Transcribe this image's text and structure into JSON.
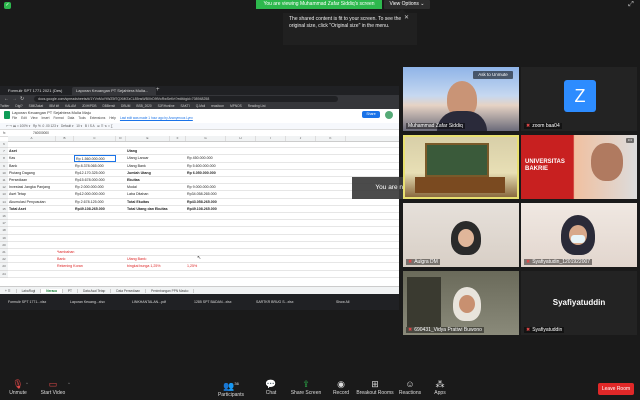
{
  "meeting": {
    "share_banner": "You are viewing Muhammad Zafar Siddiq's screen",
    "view_options": "View Options ⌄",
    "notice": "The shared content is fit to your screen. To see the original size, click \"Original size\" in the menu.",
    "breakout": "You are now in a Breakout Room"
  },
  "browser": {
    "tabs": [
      "Formulir SPT 1771 2021 (Des)",
      "Laporan Keuangan PT Sejahtera Mulia..."
    ],
    "url": "docs.google.com/spreadsheets/d/1YVnMuYtWZ5f7QXMfZzCL85nsWBXhD9fVoRwSeKrt?edit#gid=708948258",
    "bookmarks": [
      "Twitter",
      "Digi?",
      "SIMIZakat",
      "IBM kft",
      "KALAM",
      "JDIH/PDB",
      "DBBersit",
      "DBUM",
      "BSB_2020",
      "SJRHonline",
      "SAKTI",
      "Q-Mail",
      "reasitcon",
      "MPNOS",
      "Reading List"
    ],
    "doc_title": "Laporan Keuangan PT Sejahtera Mulia Maju",
    "doc_menu": [
      "File",
      "Edit",
      "View",
      "Insert",
      "Format",
      "Data",
      "Tools",
      "Extensions",
      "Help"
    ],
    "last_edit": "Last edit was made 1 hour ago by Anonymous Lynx",
    "share_label": "Share",
    "formula_value": "740000000",
    "sheet_tabs": [
      "LabaRugi",
      "Neraca",
      "PT",
      "Data Asal Tetap",
      "Data Persediaan",
      "Penimbangan PPN Masko"
    ],
    "active_sheet": "Neraca",
    "downloads": [
      "Formulir SPT 1771...xlsx",
      "Laporan Keuang...xlsx",
      "LINKHANTALAN...pdf",
      "1285 SPT BADAN...xlsx",
      "SARTKR BRUG S...xlsx"
    ],
    "show_all": "Show All"
  },
  "sheet": {
    "columns": [
      "A",
      "B",
      "C",
      "D",
      "E",
      "F",
      "G",
      "H",
      "I",
      "J",
      "K"
    ],
    "rows": [
      {
        "n": "6",
        "a": "",
        "c": "",
        "e": "",
        "g": ""
      },
      {
        "n": "7",
        "a": "Aset",
        "c": "",
        "e": "Utang",
        "g": "",
        "bold": true
      },
      {
        "n": "8",
        "a": "Kas",
        "c": "Rp  1.560.000.000",
        "e": "Utang Lancar",
        "g": "Rp    450.000.000"
      },
      {
        "n": "9",
        "a": "Bank",
        "c": "Rp  8.378.065.000",
        "e": "Utang Bank",
        "g": "Rp  5.600.000.000"
      },
      {
        "n": "10",
        "a": "Piutang Dagang",
        "c": "Rp12.170.325.000",
        "e": "Jumlah Utang",
        "g": "Rp  6.050.000.000",
        "bold_right": true
      },
      {
        "n": "11",
        "a": "Persediaan",
        "c": "Rp15.678.000.000",
        "e": "Ekuitas",
        "g": "",
        "bold_right": true
      },
      {
        "n": "12",
        "a": "Investasi Jangka Panjang",
        "c": "Rp  2.000.000.000",
        "e": "Modal",
        "g": "Rp  9.000.000.000"
      },
      {
        "n": "13",
        "a": "Aset Tetap",
        "c": "Rp12.000.000.000",
        "e": "Laba Ditahan",
        "g": "Rp34.058.265.000"
      },
      {
        "n": "14",
        "a": "Akumulasi Penyusutan",
        "c": "Rp  2.678.125.000",
        "e": "Total Ekuitas",
        "g": "Rp43.058.265.000",
        "bold_right": true
      },
      {
        "n": "15",
        "a": "Total Aset",
        "c": "Rp49.108.265.000",
        "e": "Total Utang dan Ekuitas",
        "g": "Rp49.108.265.000",
        "bold": true
      },
      {
        "n": "16",
        "a": "",
        "c": "",
        "e": "",
        "g": ""
      },
      {
        "n": "17",
        "a": "",
        "c": "",
        "e": "",
        "g": ""
      },
      {
        "n": "18",
        "a": "",
        "c": "",
        "e": "",
        "g": ""
      },
      {
        "n": "19",
        "a": "",
        "c": "",
        "e": "",
        "g": ""
      },
      {
        "n": "20",
        "a": "",
        "c": "",
        "e": "",
        "g": ""
      },
      {
        "n": "21",
        "a": "",
        "b": "*tambahan",
        "c": "",
        "e": "",
        "g": "",
        "red": true
      },
      {
        "n": "22",
        "a": "",
        "b": "Bank:",
        "c": "",
        "e": "Utang Bank:",
        "g": "",
        "red": true
      },
      {
        "n": "23",
        "a": "",
        "b": "   Rekening Koran",
        "c": "",
        "e": "   bingkai bunga 1,25%",
        "g": "1,25%",
        "red": true
      },
      {
        "n": "24",
        "a": "",
        "c": "",
        "e": "",
        "g": ""
      }
    ]
  },
  "participants": [
    {
      "name": "Muhammad Zafar Siddiq",
      "muted": false,
      "kind": "video",
      "unmute": "Ask to Unmute"
    },
    {
      "name": "zoom baa04",
      "muted": true,
      "kind": "avatar",
      "letter": "Z"
    },
    {
      "name": "",
      "muted": false,
      "kind": "classroom"
    },
    {
      "name": "",
      "muted": false,
      "kind": "banner",
      "banner_text": "UNIVERSITAS BAKRIE"
    },
    {
      "name": "Aulgra DM",
      "muted": true,
      "kind": "video"
    },
    {
      "name": "Syafiyatudin_1201922007",
      "muted": true,
      "kind": "video"
    },
    {
      "name": "690431_Vidya Pratiwi Buwono",
      "muted": true,
      "kind": "video"
    },
    {
      "name": "Syafiyatuddin",
      "muted": true,
      "kind": "name",
      "big": "Syafiyatuddin"
    }
  ],
  "toolbar": {
    "unmute": "Unmute",
    "start_video": "Start Video",
    "participants": "Participants",
    "participants_count": "36",
    "chat": "Chat",
    "share_screen": "Share Screen",
    "record": "Record",
    "breakout_rooms": "Breakout Rooms",
    "reactions": "Reactions",
    "apps": "Apps",
    "leave": "Leave Room"
  },
  "colors": {
    "zoom_blue": "#2d8cff",
    "share_green": "#2db84d",
    "leave_red": "#e02828",
    "sheets_green": "#0f9d58"
  }
}
